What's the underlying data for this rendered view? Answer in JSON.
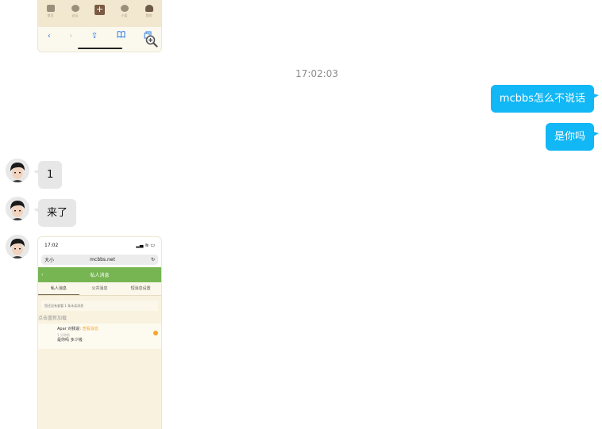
{
  "top_screenshot": {
    "tabs": [
      {
        "icon": "home-icon",
        "label": "首页"
      },
      {
        "icon": "chat-icon",
        "label": "论坛"
      },
      {
        "icon": "plus-icon",
        "label": "+"
      },
      {
        "icon": "group-icon",
        "label": "小组"
      },
      {
        "icon": "user-icon",
        "label": "我的"
      }
    ],
    "toolbar": [
      "‹",
      "›",
      "⇪",
      "📖",
      "⧉"
    ]
  },
  "timestamp": "17:02:03",
  "messages_out": [
    {
      "text": "mcbbs怎么不说话"
    },
    {
      "text": "是你吗"
    }
  ],
  "messages_in": [
    {
      "text": "1"
    },
    {
      "text": "来了"
    }
  ],
  "bottom_screenshot": {
    "status_time": "17:02",
    "status_icons": "▂▄ ≋ ▭",
    "url_left": "大小",
    "url": "mcbbs.net",
    "header_back": "‹",
    "header_title": "私人消息",
    "tabs": [
      "私人消息",
      "公共消息",
      "短消息设置"
    ],
    "notice": "您还没有查看 1 条未读消息",
    "reload": "点击重新加载",
    "msg_line1_name": "Apar 对我说:",
    "msg_line1_link": "查看消息",
    "msg_line2": "1 分钟前",
    "msg_line3": "是你吗 多少钱"
  },
  "colors": {
    "bubble_out": "#12b7f5",
    "bubble_in": "#e7e7e7",
    "header_green": "#77b553"
  }
}
